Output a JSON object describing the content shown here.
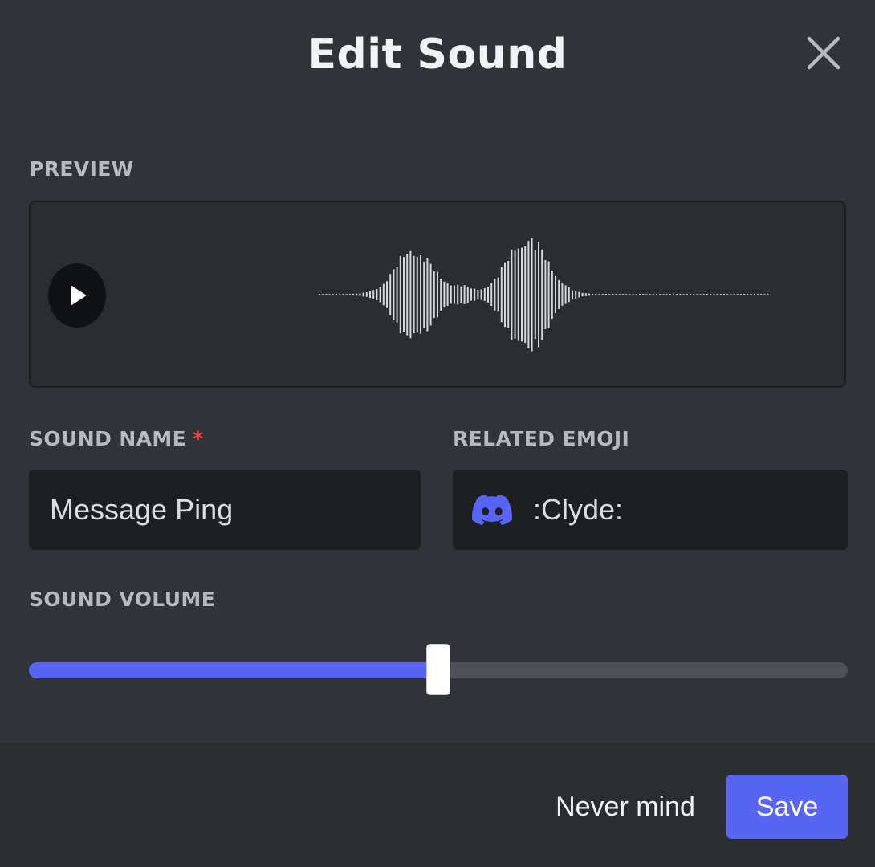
{
  "modal": {
    "title": "Edit Sound",
    "close_icon": "close-icon"
  },
  "preview": {
    "label": "PREVIEW",
    "play_icon": "play-icon"
  },
  "sound_name": {
    "label": "SOUND NAME",
    "required_mark": "*",
    "value": "Message Ping"
  },
  "related_emoji": {
    "label": "RELATED EMOJI",
    "emoji_icon": "clyde-icon",
    "value": ":Clyde:"
  },
  "sound_volume": {
    "label": "SOUND VOLUME",
    "level_fraction": 0.5
  },
  "footer": {
    "cancel_label": "Never mind",
    "save_label": "Save"
  },
  "colors": {
    "accent": "#5865f2",
    "background": "#313338",
    "input_bg": "#1e1f22",
    "required": "#f23f43"
  }
}
